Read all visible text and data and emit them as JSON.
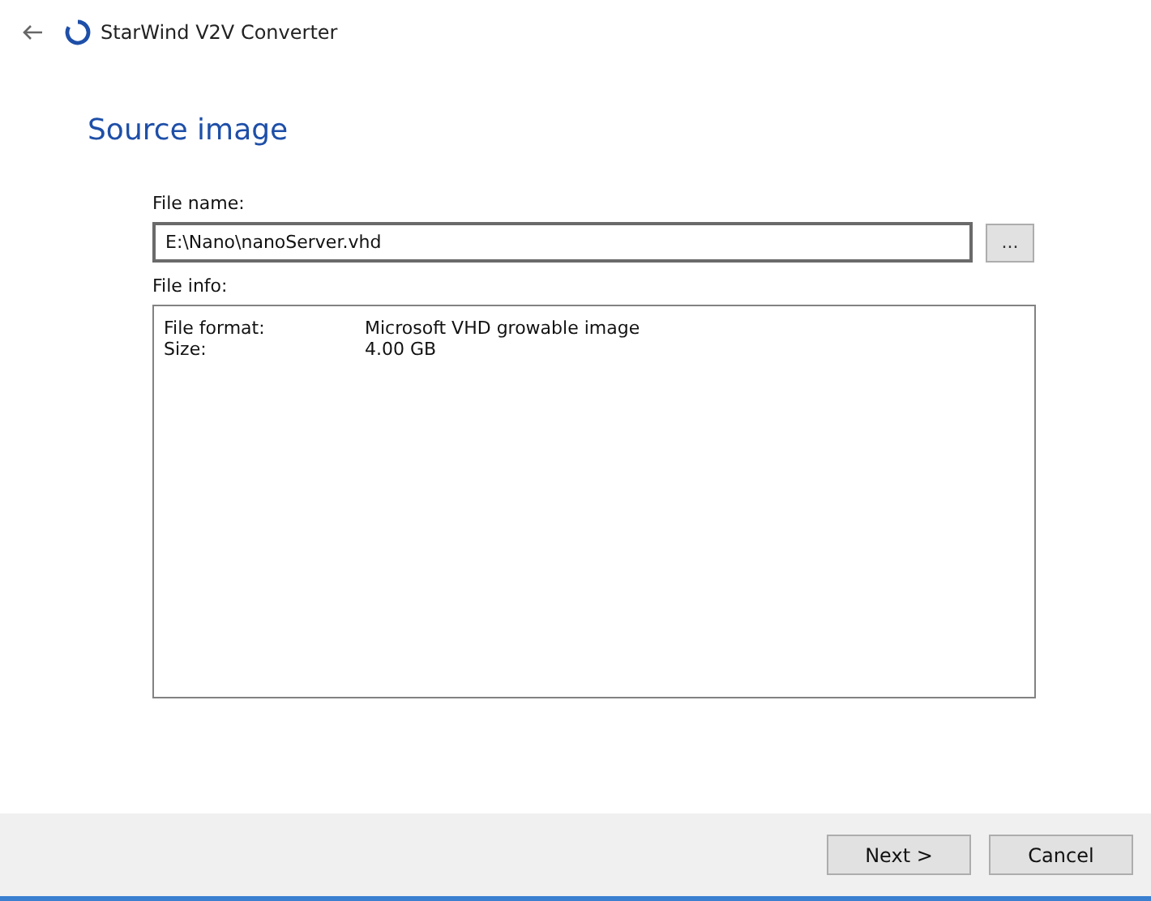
{
  "window": {
    "title": "StarWind V2V Converter"
  },
  "page_title": "Source image",
  "file_name": {
    "label": "File name:",
    "value": "E:\\Nano\\nanoServer.vhd",
    "browse": "..."
  },
  "file_info": {
    "label": "File info:",
    "rows": [
      {
        "key": "File format:",
        "value": "Microsoft VHD growable image"
      },
      {
        "key": "Size:",
        "value": "4.00 GB"
      }
    ]
  },
  "buttons": [
    {
      "label": "Next >"
    },
    {
      "label": "Cancel"
    }
  ]
}
